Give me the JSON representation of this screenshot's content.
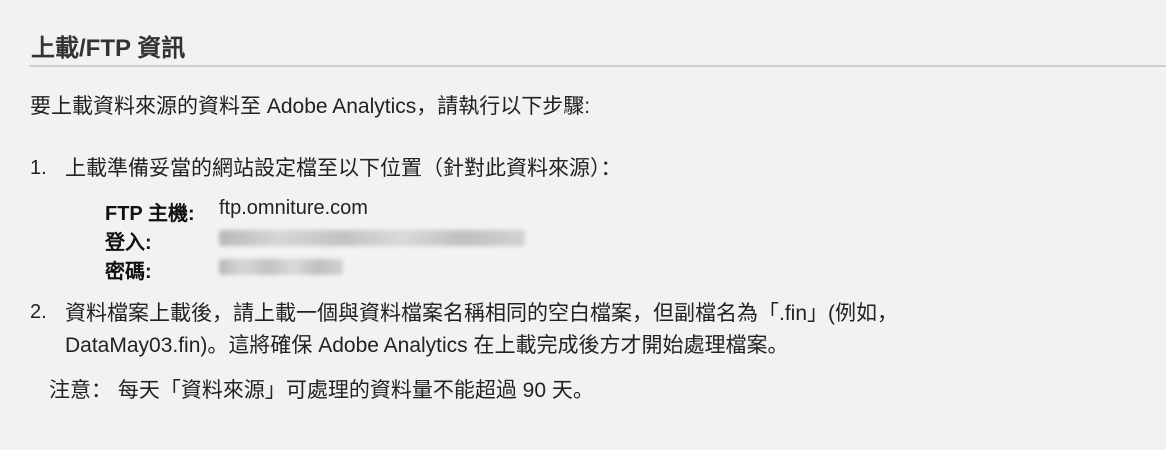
{
  "heading": "上載/FTP 資訊",
  "intro": "要上載資料來源的資料至 Adobe Analytics，請執行以下步驟:",
  "steps": [
    {
      "num": "1.",
      "text": "上載準備妥當的網站設定檔至以下位置（針對此資料來源）："
    },
    {
      "num": "2.",
      "line1": "資料檔案上載後，請上載一個與資料檔案名稱相同的空白檔案，但副檔名為「.fin」(例如，",
      "line2": "DataMay03.fin)。這將確保 Adobe Analytics 在上載完成後方才開始處理檔案。"
    }
  ],
  "ftp": {
    "host_label": "FTP 主機:",
    "host_value": "ftp.omniture.com",
    "login_label": "登入:",
    "password_label": "密碼:"
  },
  "note": "注意： 每天「資料來源」可處理的資料量不能超過 90 天。"
}
